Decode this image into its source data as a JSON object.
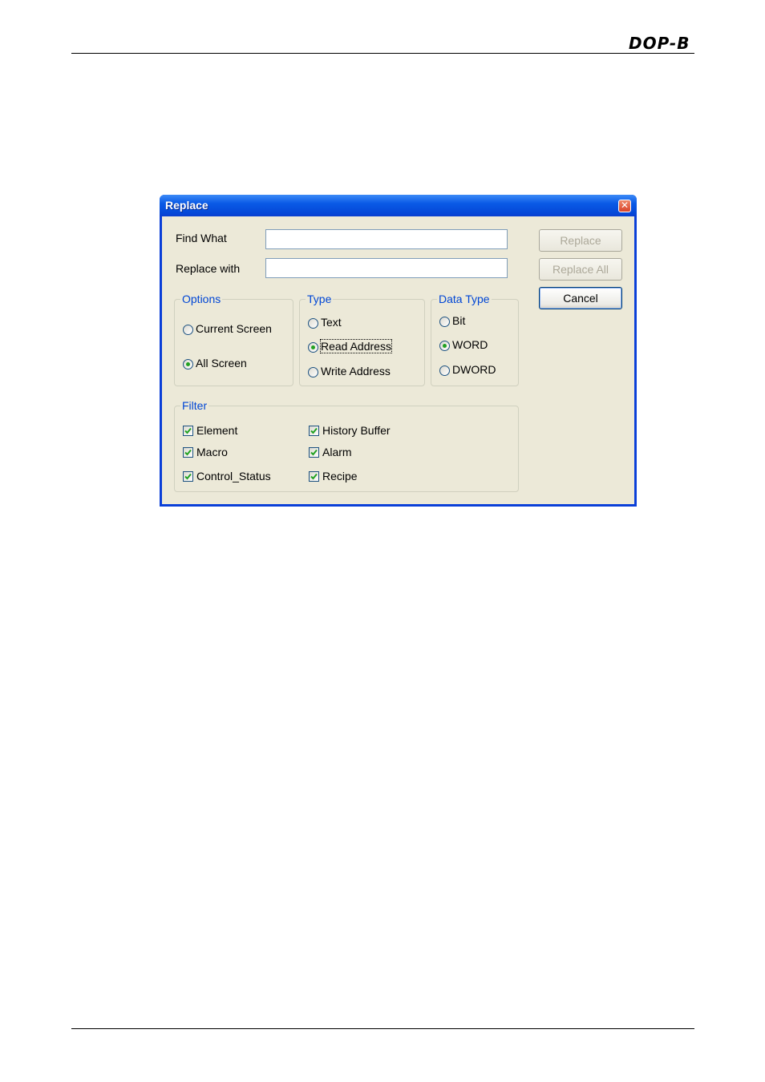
{
  "page": {
    "logo_text": "DOP-B"
  },
  "dialog": {
    "title": "Replace",
    "close_glyph": "✕",
    "find_label": "Find What",
    "find_value": "",
    "replace_label": "Replace with",
    "replace_value": "",
    "buttons": {
      "replace": "Replace",
      "replace_all": "Replace All",
      "cancel": "Cancel"
    },
    "options": {
      "legend": "Options",
      "items": [
        {
          "label": "Current Screen",
          "selected": false
        },
        {
          "label": "All Screen",
          "selected": true
        }
      ]
    },
    "type": {
      "legend": "Type",
      "items": [
        {
          "label": "Text",
          "selected": false
        },
        {
          "label": "Read Address",
          "selected": true
        },
        {
          "label": "Write Address",
          "selected": false
        }
      ]
    },
    "data_type": {
      "legend": "Data Type",
      "items": [
        {
          "label": "Bit",
          "selected": false
        },
        {
          "label": "WORD",
          "selected": true
        },
        {
          "label": "DWORD",
          "selected": false
        }
      ]
    },
    "filter": {
      "legend": "Filter",
      "items": [
        {
          "label": "Element",
          "checked": true
        },
        {
          "label": "History Buffer",
          "checked": true
        },
        {
          "label": "Macro",
          "checked": true
        },
        {
          "label": "Alarm",
          "checked": true
        },
        {
          "label": "Control_Status",
          "checked": true
        },
        {
          "label": "Recipe",
          "checked": true
        }
      ]
    }
  }
}
